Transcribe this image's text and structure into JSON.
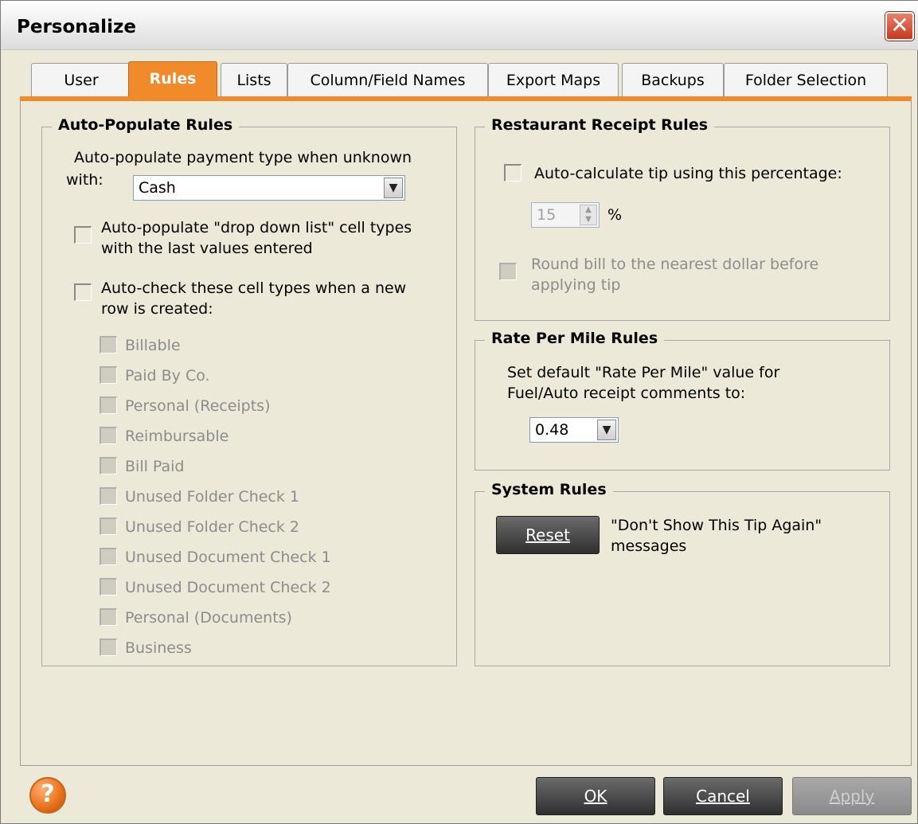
{
  "window": {
    "title": "Personalize",
    "close_glyph": "✕"
  },
  "tabs": [
    {
      "label": "User"
    },
    {
      "label": "Rules"
    },
    {
      "label": "Lists"
    },
    {
      "label": "Column/Field Names"
    },
    {
      "label": "Export Maps"
    },
    {
      "label": "Backups"
    },
    {
      "label": "Folder Selection"
    }
  ],
  "auto_populate": {
    "title": "Auto-Populate Rules",
    "payment_label_1": "Auto-populate payment type when unknown",
    "payment_label_2": "with:",
    "payment_value": "Cash",
    "dropdown_label_1": "Auto-populate \"drop down list\" cell types",
    "dropdown_label_2": "with the last values entered",
    "autocheck_label_1": "Auto-check these cell types when a new",
    "autocheck_label_2": "row is created:",
    "cell_types": [
      "Billable",
      "Paid By Co.",
      "Personal (Receipts)",
      "Reimbursable",
      "Bill Paid",
      "Unused Folder Check 1",
      "Unused Folder Check 2",
      "Unused Document Check 1",
      "Unused Document Check 2",
      "Personal (Documents)",
      "Business"
    ]
  },
  "restaurant": {
    "title": "Restaurant Receipt Rules",
    "tip_label": "Auto-calculate tip using this percentage:",
    "tip_value": "15",
    "percent": "%",
    "round_label_1": "Round bill to the nearest dollar before",
    "round_label_2": "applying tip"
  },
  "rate": {
    "title": "Rate Per Mile Rules",
    "label_1": "Set default \"Rate Per Mile\" value for",
    "label_2": "Fuel/Auto receipt comments to:",
    "value": "0.48"
  },
  "system": {
    "title": "System Rules",
    "reset_label": "Reset",
    "msg_1": "\"Don't Show This Tip Again\"",
    "msg_2": "messages"
  },
  "footer": {
    "ok": "OK",
    "cancel": "Cancel",
    "apply": "Apply",
    "help_glyph": "?"
  },
  "icons": {
    "dropdown_arrow": "chevron-down-icon",
    "help": "help-icon",
    "close": "close-icon"
  },
  "colors": {
    "accent": "#f08a2a",
    "close": "#c6381f"
  }
}
